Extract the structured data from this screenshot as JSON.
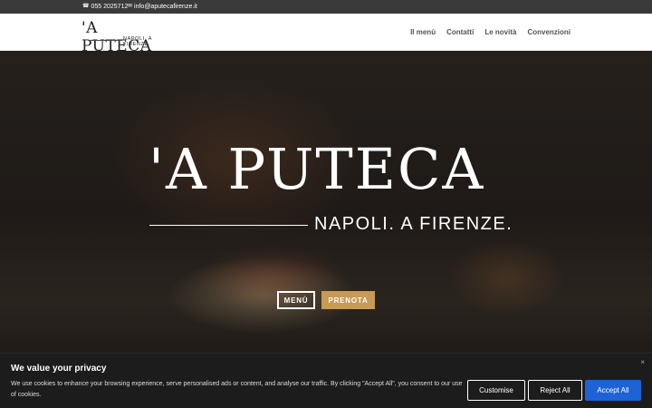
{
  "topbar": {
    "phone_icon": "phone-icon",
    "phone": "055 2025712",
    "mail_icon": "envelope-icon",
    "email": "info@aputecafirenze.it"
  },
  "header": {
    "logo_main": "'A PUTECA",
    "logo_sub": "NAPOLI. A FIRENZE.",
    "nav": [
      "Il menù",
      "Contatti",
      "Le novità",
      "Convenzioni"
    ]
  },
  "hero": {
    "title": "'A PUTECA",
    "subtitle": "NAPOLI. A FIRENZE.",
    "menu_button": "MENÙ",
    "prenota_button": "PRENOTA",
    "accent_color": "#c79a55"
  },
  "cookie": {
    "title": "We value your privacy",
    "text": "We use cookies to enhance your browsing experience, serve personalised ads or content, and analyse our traffic. By clicking \"Accept All\", you consent to our use of cookies.",
    "close": "×",
    "customise": "Customise",
    "reject": "Reject All",
    "accept": "Accept All",
    "accept_color": "#1e63d6"
  }
}
